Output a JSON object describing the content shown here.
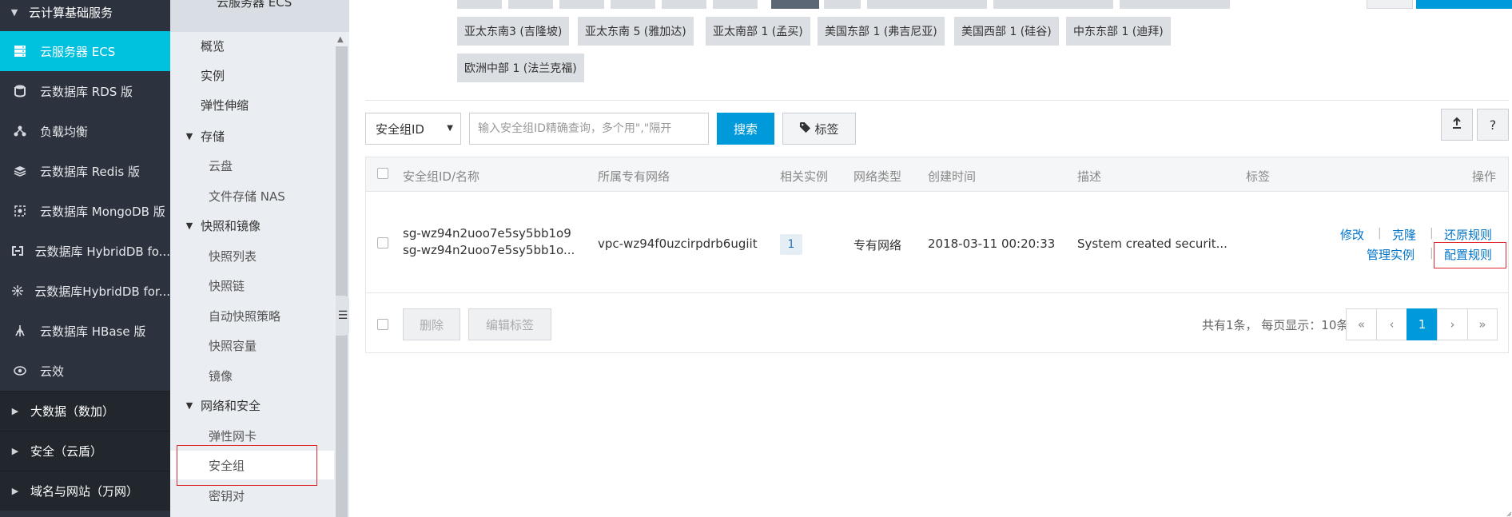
{
  "leftnav": {
    "group": "云计算基础服务",
    "items": [
      {
        "label": "云服务器 ECS",
        "icon": "server-icon",
        "active": true
      },
      {
        "label": "云数据库 RDS 版",
        "icon": "database-icon"
      },
      {
        "label": "负载均衡",
        "icon": "load-balancer-icon"
      },
      {
        "label": "云数据库 Redis 版",
        "icon": "redis-icon"
      },
      {
        "label": "云数据库 MongoDB 版",
        "icon": "mongodb-icon"
      },
      {
        "label": "云数据库 HybridDB fo...",
        "icon": "hybriddb-icon"
      },
      {
        "label": "云数据库HybridDB for...",
        "icon": "hybriddb-star-icon"
      },
      {
        "label": "云数据库 HBase 版",
        "icon": "hbase-icon"
      },
      {
        "label": "云效",
        "icon": "eye-icon"
      }
    ],
    "bottom": [
      {
        "label": "大数据（数加）"
      },
      {
        "label": "安全（云盾）"
      },
      {
        "label": "域名与网站（万网）"
      }
    ]
  },
  "subnav": {
    "title": "云服务器 ECS",
    "items": [
      {
        "label": "概览",
        "type": "lvl1"
      },
      {
        "label": "实例",
        "type": "lvl1"
      },
      {
        "label": "弹性伸缩",
        "type": "lvl1"
      },
      {
        "label": "存储",
        "type": "sec"
      },
      {
        "label": "云盘",
        "type": "lvl2"
      },
      {
        "label": "文件存储 NAS",
        "type": "lvl2"
      },
      {
        "label": "快照和镜像",
        "type": "sec"
      },
      {
        "label": "快照列表",
        "type": "lvl2"
      },
      {
        "label": "快照链",
        "type": "lvl2"
      },
      {
        "label": "自动快照策略",
        "type": "lvl2"
      },
      {
        "label": "快照容量",
        "type": "lvl2"
      },
      {
        "label": "镜像",
        "type": "lvl2"
      },
      {
        "label": "网络和安全",
        "type": "sec"
      },
      {
        "label": "弹性网卡",
        "type": "lvl2"
      },
      {
        "label": "安全组",
        "type": "lvl2",
        "selected": true
      },
      {
        "label": "密钥对",
        "type": "lvl2"
      }
    ]
  },
  "regions": {
    "row1": [
      "亚太东南3 (吉隆坡)",
      "亚太东南 5 (雅加达)",
      "亚太南部 1 (孟买)",
      "美国东部 1 (弗吉尼亚)",
      "美国西部 1 (硅谷)",
      "中东东部 1 (迪拜)"
    ],
    "row2": [
      "欧洲中部 1 (法兰克福)"
    ]
  },
  "filter": {
    "select_value": "安全组ID",
    "search_placeholder": "输入安全组ID精确查询，多个用\",\"隔开",
    "search_label": "搜索",
    "tag_label": "标签",
    "help_label": "?"
  },
  "table": {
    "headers": {
      "id_name": "安全组ID/名称",
      "vpc": "所属专有网络",
      "instances": "相关实例",
      "net_type": "网络类型",
      "created": "创建时间",
      "desc": "描述",
      "tags": "标签",
      "ops": "操作"
    },
    "rows": [
      {
        "id": "sg-wz94n2uoo7e5sy5bb1o9",
        "name": "sg-wz94n2uoo7e5sy5bb1o...",
        "vpc": "vpc-wz94f0uzcirpdrb6ugiit",
        "instances": "1",
        "net_type": "专有网络",
        "created": "2018-03-11 00:20:33",
        "desc": "System created securit...",
        "ops": {
          "modify": "修改",
          "clone": "克隆",
          "restore": "还原规则",
          "manage": "管理实例",
          "config": "配置规则"
        }
      }
    ],
    "footer": {
      "delete_label": "删除",
      "edit_tags_label": "编辑标签",
      "summary": "共有1条， 每页显示：10条",
      "pages": {
        "first": "«",
        "prev": "‹",
        "current": "1",
        "next": "›",
        "last": "»"
      }
    }
  },
  "colors": {
    "accent": "#0099d9",
    "nav_active": "#00c1de",
    "nav_bg": "#2d333e",
    "highlight": "#e0282e",
    "link": "#0073c8"
  }
}
